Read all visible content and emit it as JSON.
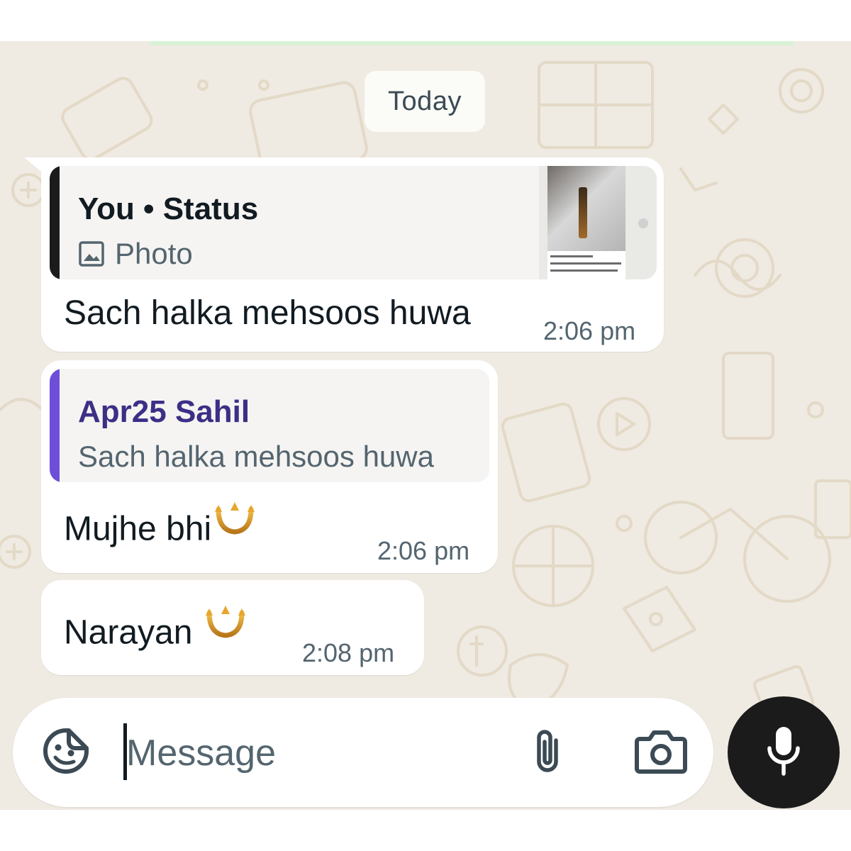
{
  "date_chip": "Today",
  "messages": [
    {
      "quote": {
        "title": "You • Status",
        "subtitle": "Photo",
        "icon": "photo-icon"
      },
      "text": "Sach halka mehsoos huwa",
      "time": "2:06 pm"
    },
    {
      "quote": {
        "title": "Apr25 Sahil",
        "subtitle": "Sach halka mehsoos huwa"
      },
      "text": "Mujhe bhi",
      "emoji": "trident-emoji",
      "time": "2:06 pm"
    },
    {
      "text": "Narayan",
      "emoji": "trident-emoji",
      "time": "2:08 pm"
    }
  ],
  "composer": {
    "placeholder": "Message",
    "icons": [
      "sticker-icon",
      "attach-icon",
      "camera-icon",
      "mic-icon"
    ]
  },
  "colors": {
    "chat_background": "#efeae2",
    "bubble": "#ffffff",
    "quote_bar_status": "#1b1b1b",
    "quote_bar_reply": "#6d4ed9",
    "reply_author": "#3b2f86",
    "mic_button": "#1b1b1b"
  }
}
